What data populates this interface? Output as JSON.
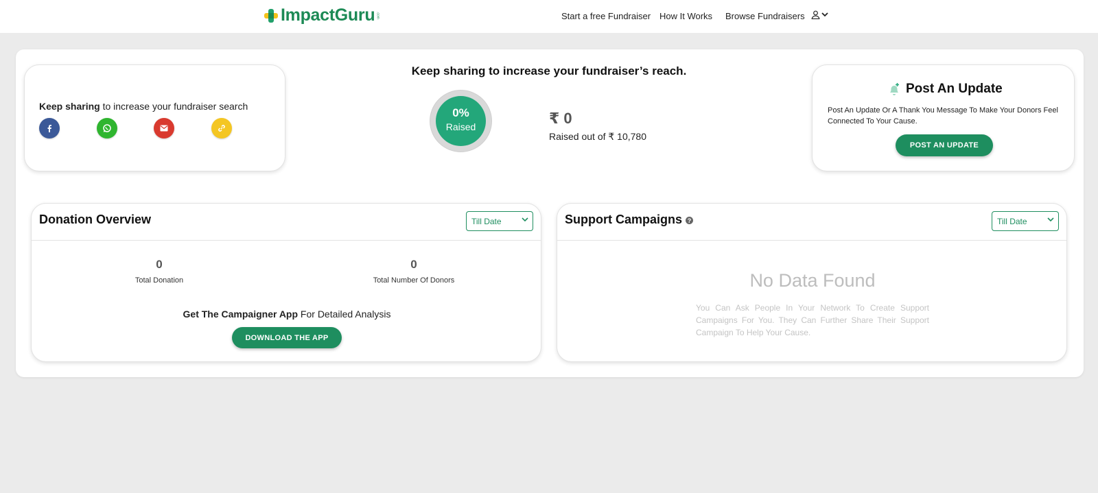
{
  "header": {
    "logo_text": "ImpactGuru",
    "logo_sub": ".com",
    "nav": [
      "Start a free Fundraiser",
      "How It Works",
      "Browse Fundraisers"
    ]
  },
  "share": {
    "bold": "Keep sharing",
    "rest": " to increase your fundraiser search",
    "icons": [
      "facebook-icon",
      "whatsapp-icon",
      "email-icon",
      "link-icon"
    ]
  },
  "progress": {
    "title": "Keep sharing to increase your fundraiser’s reach.",
    "percent": "0%",
    "raised_label": "Raised",
    "percent_value": 0,
    "amount": "₹ 0",
    "raised_of": "Raised out of ₹ 10,780"
  },
  "update": {
    "title": "Post An Update",
    "description": "Post An Update Or A Thank You Message To Make Your Donors Feel Connected To Your Cause.",
    "button": "POST AN UPDATE"
  },
  "donation": {
    "title": "Donation Overview",
    "filter": "Till Date",
    "total_donation_value": "0",
    "total_donation_label": "Total Donation",
    "donors_value": "0",
    "donors_label": "Total Number Of Donors",
    "campaigner_bold": "Get The Campaigner App",
    "campaigner_rest": " For Detailed Analysis",
    "download_button": "DOWNLOAD THE APP"
  },
  "support": {
    "title": "Support Campaigns",
    "help_glyph": "?",
    "filter": "Till Date",
    "empty_title": "No Data Found",
    "empty_desc": "You Can Ask People In Your Network To Create Support Campaigns For You. They Can Further Share Their Support Campaign To Help Your Cause."
  },
  "colors": {
    "brand_green": "#1e8e5f",
    "ring_green": "#23a77a",
    "facebook": "#3b5998",
    "whatsapp": "#2fb52f",
    "email": "#d93a2f",
    "link": "#f4c623"
  }
}
